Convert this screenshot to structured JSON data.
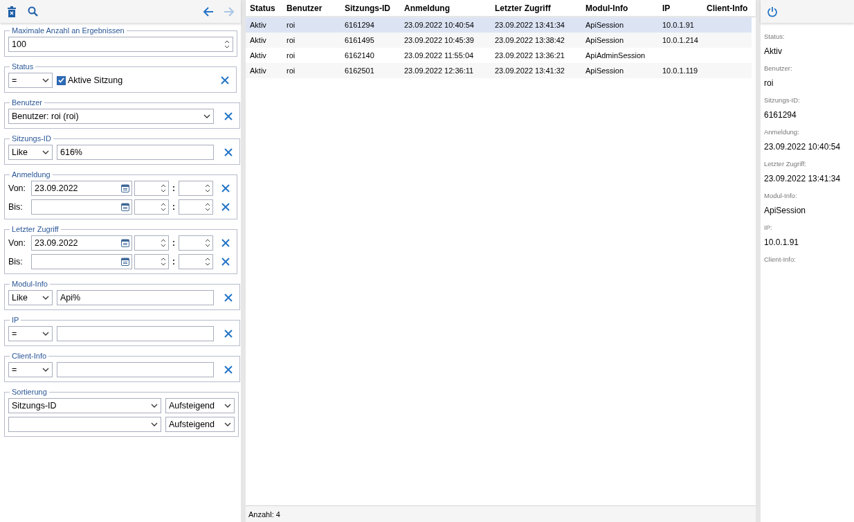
{
  "left_toolbar": {
    "actions": [
      {
        "kind": "delete"
      },
      {
        "kind": "search"
      }
    ],
    "nav": [
      {
        "kind": "back",
        "disabled": false
      },
      {
        "kind": "forward",
        "disabled": true
      }
    ]
  },
  "filters": [
    {
      "kind": "number",
      "legend": "Maximale Anzahl an Ergebnissen",
      "value": "100"
    },
    {
      "kind": "checkbox",
      "legend": "Status",
      "operator": "=",
      "checkbox": {
        "label": "Aktive Sitzung",
        "checked": true
      }
    },
    {
      "kind": "combo",
      "legend": "Benutzer",
      "value": "Benutzer: roi (roi)"
    },
    {
      "kind": "text",
      "legend": "Sitzungs-ID",
      "operator": "Like",
      "value": "616%"
    },
    {
      "kind": "daterange",
      "legend": "Anmeldung",
      "rows": [
        {
          "label": "Von:",
          "date": "23.09.2022",
          "separator": ":"
        },
        {
          "label": "Bis:",
          "separator": ":"
        }
      ]
    },
    {
      "kind": "daterange",
      "legend": "Letzter Zugriff",
      "rows": [
        {
          "label": "Von:",
          "date": "23.09.2022",
          "separator": ":"
        },
        {
          "label": "Bis:",
          "separator": ":"
        }
      ]
    },
    {
      "kind": "text",
      "legend": "Modul-Info",
      "operator": "Like",
      "value": "Api%"
    },
    {
      "kind": "text",
      "legend": "IP",
      "operator": "="
    },
    {
      "kind": "text",
      "legend": "Client-Info",
      "operator": "="
    },
    {
      "kind": "sort",
      "legend": "Sortierung",
      "rows": [
        {
          "field": "Sitzungs-ID",
          "order": "Aufsteigend"
        },
        {
          "order": "Aufsteigend"
        }
      ]
    }
  ],
  "table": {
    "columns": [
      "Status",
      "Benutzer",
      "Sitzungs-ID",
      "Anmeldung",
      "Letzter Zugriff",
      "Modul-Info",
      "IP",
      "Client-Info"
    ],
    "rows": [
      {
        "selected": true,
        "cells": [
          "Aktiv",
          "roi",
          "6161294",
          "23.09.2022 10:40:54",
          "23.09.2022 13:41:34",
          "ApiSession",
          "10.0.1.91",
          ""
        ]
      },
      {
        "selected": false,
        "cells": [
          "Aktiv",
          "roi",
          "6161495",
          "23.09.2022 10:45:39",
          "23.09.2022 13:38:42",
          "ApiSession",
          "10.0.1.214",
          ""
        ]
      },
      {
        "selected": false,
        "cells": [
          "Aktiv",
          "roi",
          "6162140",
          "23.09.2022 11:55:04",
          "23.09.2022 13:36:21",
          "ApiAdminSession",
          "",
          ""
        ]
      },
      {
        "selected": false,
        "cells": [
          "Aktiv",
          "roi",
          "6162501",
          "23.09.2022 12:36:11",
          "23.09.2022 13:41:32",
          "ApiSession",
          "10.0.1.119",
          ""
        ]
      }
    ]
  },
  "status_bar": {
    "text": "Anzahl: 4"
  },
  "details": {
    "fields": [
      {
        "label": "Status:",
        "value": "Aktiv"
      },
      {
        "label": "Benutzer:",
        "value": "roi"
      },
      {
        "label": "Sitzungs-ID:",
        "value": "6161294"
      },
      {
        "label": "Anmeldung:",
        "value": "23.09.2022 10:40:54"
      },
      {
        "label": "Letzter Zugriff:",
        "value": "23.09.2022 13:41:34"
      },
      {
        "label": "Modul-Info:",
        "value": "ApiSession"
      },
      {
        "label": "IP:",
        "value": "10.0.1.91"
      },
      {
        "label": "Client-Info:"
      }
    ]
  }
}
